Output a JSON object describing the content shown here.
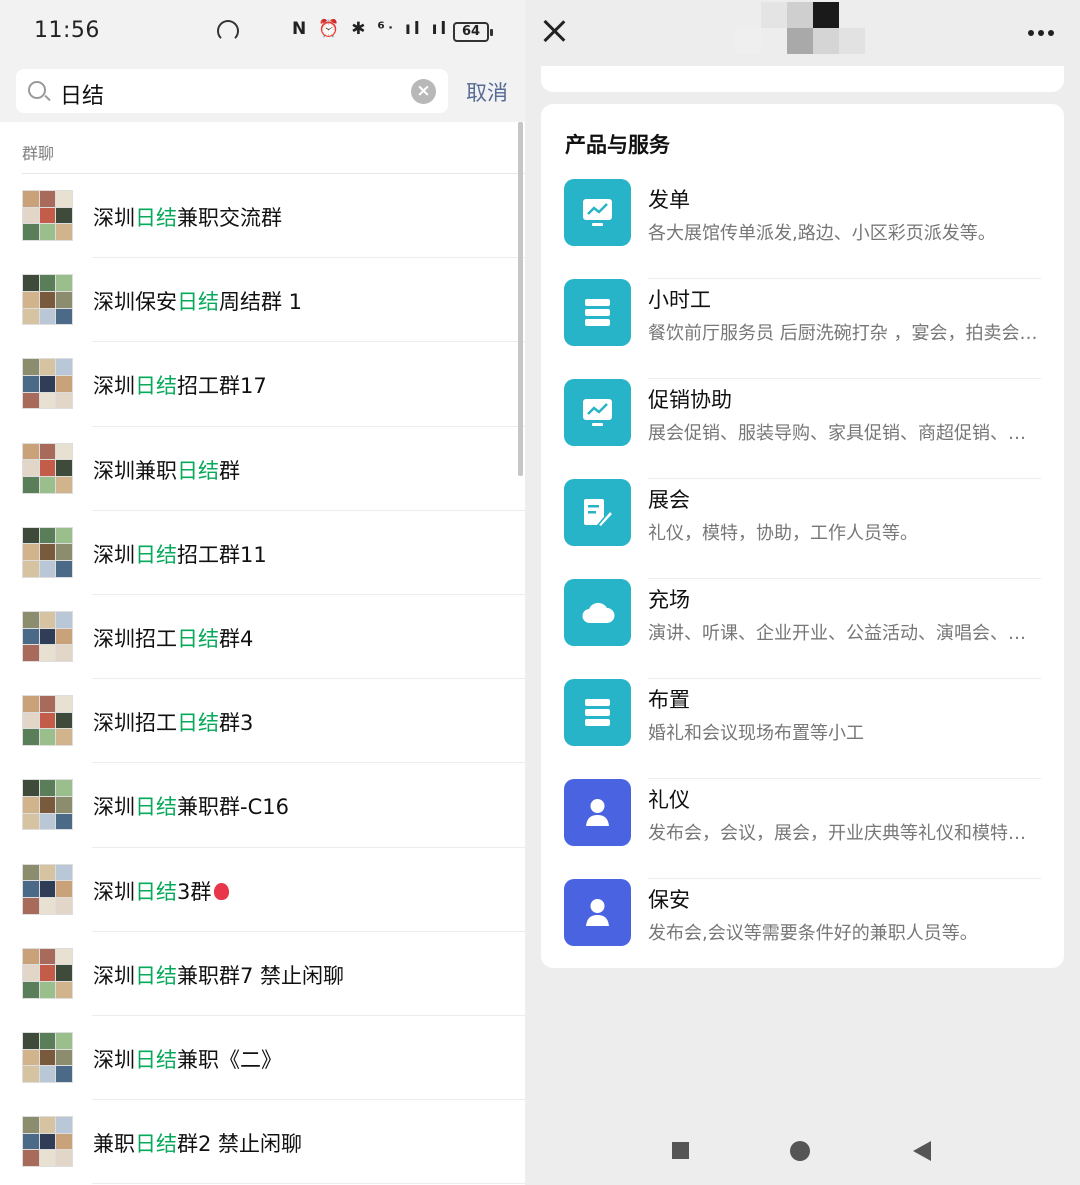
{
  "left_screen": {
    "status_bar": {
      "time": "11:56",
      "icons": "N ⏰ ✱ ⁶ᐧ ıl ıl",
      "battery": "64"
    },
    "search": {
      "query": "日结",
      "cancel_label": "取消"
    },
    "section_label": "群聊",
    "chats": [
      {
        "pre": "深圳",
        "hl": "日结",
        "post": "兼职交流群",
        "balloon": false
      },
      {
        "pre": "深圳保安",
        "hl": "日结",
        "post": "周结群 1",
        "balloon": false
      },
      {
        "pre": "深圳",
        "hl": "日结",
        "post": "招工群17",
        "balloon": false
      },
      {
        "pre": "深圳兼职",
        "hl": "日结",
        "post": "群",
        "balloon": false
      },
      {
        "pre": "深圳",
        "hl": "日结",
        "post": "招工群11",
        "balloon": false
      },
      {
        "pre": "深圳招工",
        "hl": "日结",
        "post": "群4",
        "balloon": false
      },
      {
        "pre": "深圳招工",
        "hl": "日结",
        "post": "群3",
        "balloon": false
      },
      {
        "pre": "深圳",
        "hl": "日结",
        "post": "兼职群-C16",
        "balloon": false
      },
      {
        "pre": "深圳",
        "hl": "日结",
        "post": "3群",
        "balloon": true
      },
      {
        "pre": "深圳",
        "hl": "日结",
        "post": "兼职群7  禁止闲聊",
        "balloon": false
      },
      {
        "pre": "深圳",
        "hl": "日结",
        "post": "兼职《二》",
        "balloon": false
      },
      {
        "pre": "兼职",
        "hl": "日结",
        "post": "群2  禁止闲聊",
        "balloon": false
      }
    ]
  },
  "right_screen": {
    "section_title": "产品与服务",
    "services": [
      {
        "name": "发单",
        "desc": "各大展馆传单派发,路边、小区彩页派发等。",
        "icon": "chart-monitor-icon",
        "color": "#27b3c8"
      },
      {
        "name": "小时工",
        "desc": "餐饮前厅服务员 后厨洗碗打杂 ，宴会，拍卖会，展会服务",
        "icon": "server-stack-icon",
        "color": "#27b3c8"
      },
      {
        "name": "促销协助",
        "desc": "展会促销、服装导购、家具促销、商超促销、派单等",
        "icon": "chart-monitor-icon",
        "color": "#27b3c8"
      },
      {
        "name": "展会",
        "desc": "礼仪，模特，协助，工作人员等。",
        "icon": "edit-tool-icon",
        "color": "#27b3c8"
      },
      {
        "name": "充场",
        "desc": "演讲、听课、企业开业、公益活动、演唱会、发布会等",
        "icon": "cloud-icon",
        "color": "#27b3c8"
      },
      {
        "name": "布置",
        "desc": "婚礼和会议现场布置等小工",
        "icon": "server-stack-icon",
        "color": "#27b3c8"
      },
      {
        "name": "礼仪",
        "desc": "发布会，会议，展会，开业庆典等礼仪和模特人员",
        "icon": "person-icon",
        "color": "#4a63e0"
      },
      {
        "name": "保安",
        "desc": "发布会,会议等需要条件好的兼职人员等。",
        "icon": "person-icon",
        "color": "#4a63e0"
      }
    ]
  }
}
